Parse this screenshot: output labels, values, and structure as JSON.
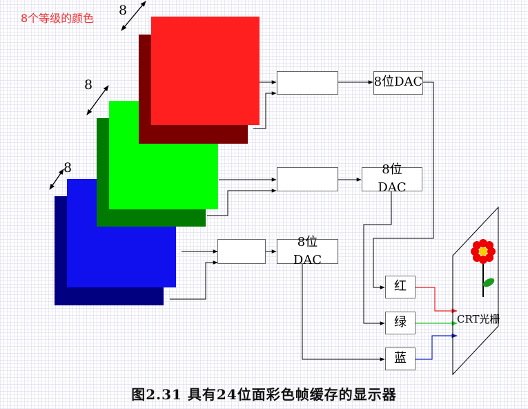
{
  "annotation": {
    "text": "8个等级的颜色",
    "color": "#ee3333"
  },
  "bit_depth_labels": {
    "red": "8",
    "green": "8",
    "blue": "8"
  },
  "dac_labels": {
    "red": "8位DAC",
    "green_line1": "8位",
    "green_line2": "DAC",
    "blue_line1": "8位",
    "blue_line2": "DAC"
  },
  "channels": {
    "red": "红",
    "green": "绿",
    "blue": "蓝"
  },
  "screen_label": "CRT光栅",
  "caption": "图2.31  具有24位面彩色帧缓存的显示器",
  "colors": {
    "red_front": "#ff1f1f",
    "red_back": "#7a0000",
    "green_front": "#00ff00",
    "green_back": "#007a00",
    "blue_front": "#1010ee",
    "blue_back": "#000080",
    "red_line": "#e8403a",
    "green_line": "#33dd33",
    "blue_line": "#2030c0"
  }
}
